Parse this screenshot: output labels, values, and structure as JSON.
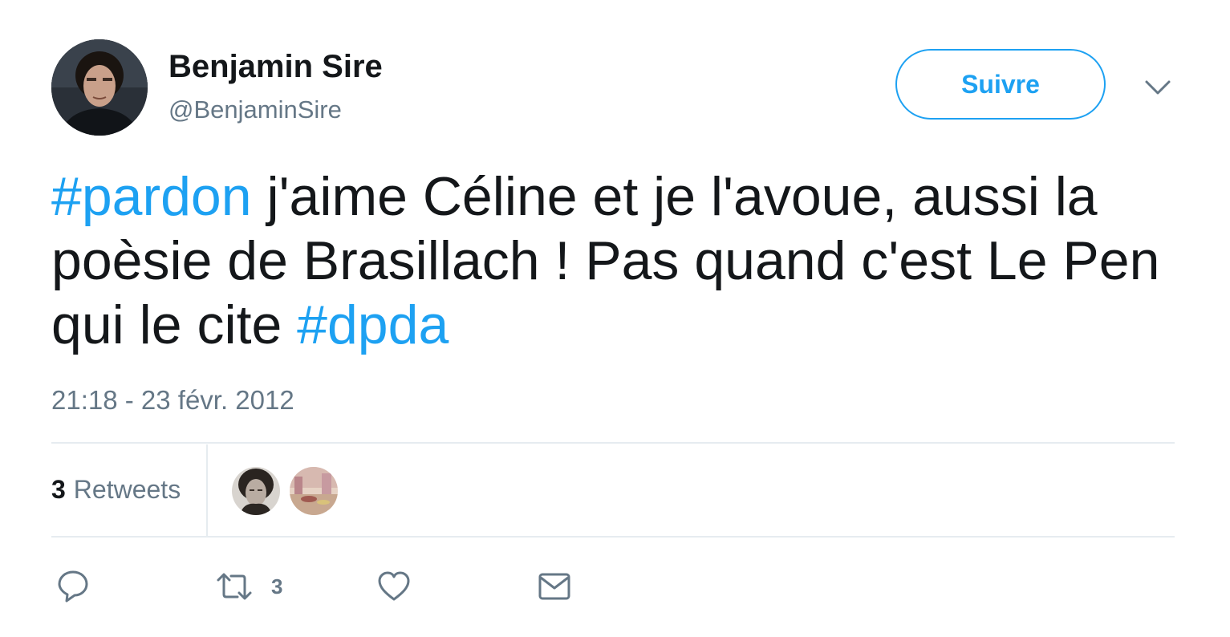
{
  "author": {
    "display_name": "Benjamin Sire",
    "screen_name": "@BenjaminSire"
  },
  "follow_button": {
    "label": "Suivre"
  },
  "tweet": {
    "hashtag_1": "#pardon",
    "text_1": " j'aime Céline et je l'avoue, aussi la poèsie de Brasillach ! Pas quand c'est Le Pen qui le cite ",
    "hashtag_2": "#dpda",
    "timestamp": "21:18 - 23 févr. 2012"
  },
  "stats": {
    "retweet_count": "3",
    "retweet_label": "Retweets"
  },
  "actions": {
    "reply_icon": "reply-icon",
    "retweet_icon": "retweet-icon",
    "retweet_count": "3",
    "like_icon": "heart-icon",
    "dm_icon": "envelope-icon"
  },
  "colors": {
    "accent": "#1da1f2",
    "text_primary": "#14171a",
    "text_secondary": "#657786",
    "divider": "#e6ecf0"
  }
}
